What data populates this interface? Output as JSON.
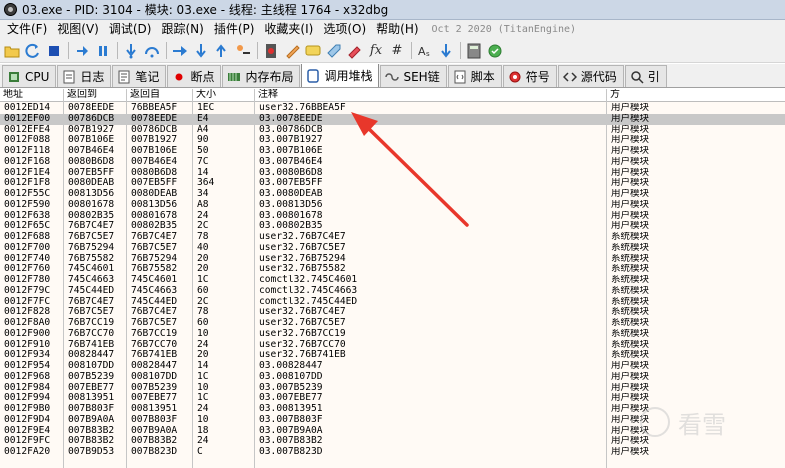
{
  "window": {
    "title": "03.exe - PID: 3104 - 模块: 03.exe - 线程: 主线程 1764 - x32dbg"
  },
  "menu": {
    "items": [
      "文件(F)",
      "视图(V)",
      "调试(D)",
      "跟踪(N)",
      "插件(P)",
      "收藏夹(I)",
      "选项(O)",
      "帮助(H)"
    ],
    "date": "Oct 2 2020 (TitanEngine)"
  },
  "toolbar": {
    "icons": [
      "open-folder-icon",
      "restart-icon",
      "stop-icon",
      "run-icon",
      "pause-icon",
      "step-into-icon",
      "step-over-icon",
      "trace-into-icon",
      "trace-over-icon",
      "execute-till-return-icon",
      "run-to-user-code-icon",
      "trace-record-icon",
      "patch-icon",
      "comment-icon",
      "label-icon",
      "bookmark-icon",
      "function-icon",
      "hash-icon",
      "font-icon",
      "strings-icon",
      "calculator-icon",
      "check-update-icon"
    ],
    "fx_label": "fx",
    "hash_label": "#"
  },
  "tabs": [
    {
      "name": "tab-cpu",
      "label": "CPU",
      "icon": "cpu-icon"
    },
    {
      "name": "tab-log",
      "label": "日志",
      "icon": "log-icon"
    },
    {
      "name": "tab-notes",
      "label": "笔记",
      "icon": "notes-icon"
    },
    {
      "name": "tab-breakpoints",
      "label": "断点",
      "icon": "breakpoint-icon"
    },
    {
      "name": "tab-memory-map",
      "label": "内存布局",
      "icon": "memory-map-icon"
    },
    {
      "name": "tab-call-stack",
      "label": "调用堆栈",
      "icon": "call-stack-icon",
      "active": true
    },
    {
      "name": "tab-seh",
      "label": "SEH链",
      "icon": "seh-icon"
    },
    {
      "name": "tab-script",
      "label": "脚本",
      "icon": "script-icon"
    },
    {
      "name": "tab-symbols",
      "label": "符号",
      "icon": "symbols-icon"
    },
    {
      "name": "tab-source",
      "label": "源代码",
      "icon": "source-icon"
    },
    {
      "name": "tab-references",
      "label": "引",
      "icon": "search-icon"
    }
  ],
  "table": {
    "headers": {
      "address": "地址",
      "return_to": "返回到",
      "return_from": "返回自",
      "size": "大小",
      "comment": "注释",
      "party": "方"
    },
    "selected_index": 1,
    "rows": [
      [
        "0012ED14",
        "0078EEDE",
        "76BBEA5F",
        "1EC",
        "user32.76BBEA5F",
        "用户模块"
      ],
      [
        "0012EF00",
        "00786DCB",
        "0078EEDE",
        "E4",
        "03.0078EEDE",
        "用户模块"
      ],
      [
        "0012EFE4",
        "007B1927",
        "00786DCB",
        "A4",
        "03.00786DCB",
        "用户模块"
      ],
      [
        "0012F088",
        "007B106E",
        "007B1927",
        "90",
        "03.007B1927",
        "用户模块"
      ],
      [
        "0012F118",
        "007B46E4",
        "007B106E",
        "50",
        "03.007B106E",
        "用户模块"
      ],
      [
        "0012F168",
        "0080B6D8",
        "007B46E4",
        "7C",
        "03.007B46E4",
        "用户模块"
      ],
      [
        "0012F1E4",
        "007EB5FF",
        "0080B6D8",
        "14",
        "03.0080B6D8",
        "用户模块"
      ],
      [
        "0012F1F8",
        "0080DEAB",
        "007EB5FF",
        "364",
        "03.007EB5FF",
        "用户模块"
      ],
      [
        "0012F55C",
        "00813D56",
        "0080DEAB",
        "34",
        "03.0080DEAB",
        "用户模块"
      ],
      [
        "0012F590",
        "00801678",
        "00813D56",
        "A8",
        "03.00813D56",
        "用户模块"
      ],
      [
        "0012F638",
        "00802B35",
        "00801678",
        "24",
        "03.00801678",
        "用户模块"
      ],
      [
        "0012F65C",
        "76B7C4E7",
        "00802B35",
        "2C",
        "03.00802B35",
        "用户模块"
      ],
      [
        "0012F688",
        "76B7C5E7",
        "76B7C4E7",
        "78",
        "user32.76B7C4E7",
        "系统模块"
      ],
      [
        "0012F700",
        "76B75294",
        "76B7C5E7",
        "40",
        "user32.76B7C5E7",
        "系统模块"
      ],
      [
        "0012F740",
        "76B75582",
        "76B75294",
        "20",
        "user32.76B75294",
        "系统模块"
      ],
      [
        "0012F760",
        "745C4601",
        "76B75582",
        "20",
        "user32.76B75582",
        "系统模块"
      ],
      [
        "0012F780",
        "745C4663",
        "745C4601",
        "1C",
        "comctl32.745C4601",
        "系统模块"
      ],
      [
        "0012F79C",
        "745C44ED",
        "745C4663",
        "60",
        "comctl32.745C4663",
        "系统模块"
      ],
      [
        "0012F7FC",
        "76B7C4E7",
        "745C44ED",
        "2C",
        "comctl32.745C44ED",
        "系统模块"
      ],
      [
        "0012F828",
        "76B7C5E7",
        "76B7C4E7",
        "78",
        "user32.76B7C4E7",
        "系统模块"
      ],
      [
        "0012F8A0",
        "76B7CC19",
        "76B7C5E7",
        "60",
        "user32.76B7C5E7",
        "系统模块"
      ],
      [
        "0012F900",
        "76B7CC70",
        "76B7CC19",
        "10",
        "user32.76B7CC19",
        "系统模块"
      ],
      [
        "0012F910",
        "76B741EB",
        "76B7CC70",
        "24",
        "user32.76B7CC70",
        "系统模块"
      ],
      [
        "0012F934",
        "00828447",
        "76B741EB",
        "20",
        "user32.76B741EB",
        "系统模块"
      ],
      [
        "0012F954",
        "008107DD",
        "00828447",
        "14",
        "03.00828447",
        "用户模块"
      ],
      [
        "0012F968",
        "007B5239",
        "008107DD",
        "1C",
        "03.008107DD",
        "用户模块"
      ],
      [
        "0012F984",
        "007EBE77",
        "007B5239",
        "10",
        "03.007B5239",
        "用户模块"
      ],
      [
        "0012F994",
        "00813951",
        "007EBE77",
        "1C",
        "03.007EBE77",
        "用户模块"
      ],
      [
        "0012F9B0",
        "007B803F",
        "00813951",
        "24",
        "03.00813951",
        "用户模块"
      ],
      [
        "0012F9D4",
        "007B9A0A",
        "007B803F",
        "10",
        "03.007B803F",
        "用户模块"
      ],
      [
        "0012F9E4",
        "007B83B2",
        "007B9A0A",
        "18",
        "03.007B9A0A",
        "用户模块"
      ],
      [
        "0012F9FC",
        "007B83B2",
        "007B83B2",
        "24",
        "03.007B83B2",
        "用户模块"
      ],
      [
        "0012FA20",
        "007B9D53",
        "007B823D",
        "C",
        "03.007B823D",
        "用户模块"
      ]
    ]
  },
  "watermark": {
    "text": "看雪"
  },
  "colors": {
    "arrow": "#e8372b",
    "selected_row": "#c8c8c8",
    "grid_bg": "#fffaf5"
  }
}
